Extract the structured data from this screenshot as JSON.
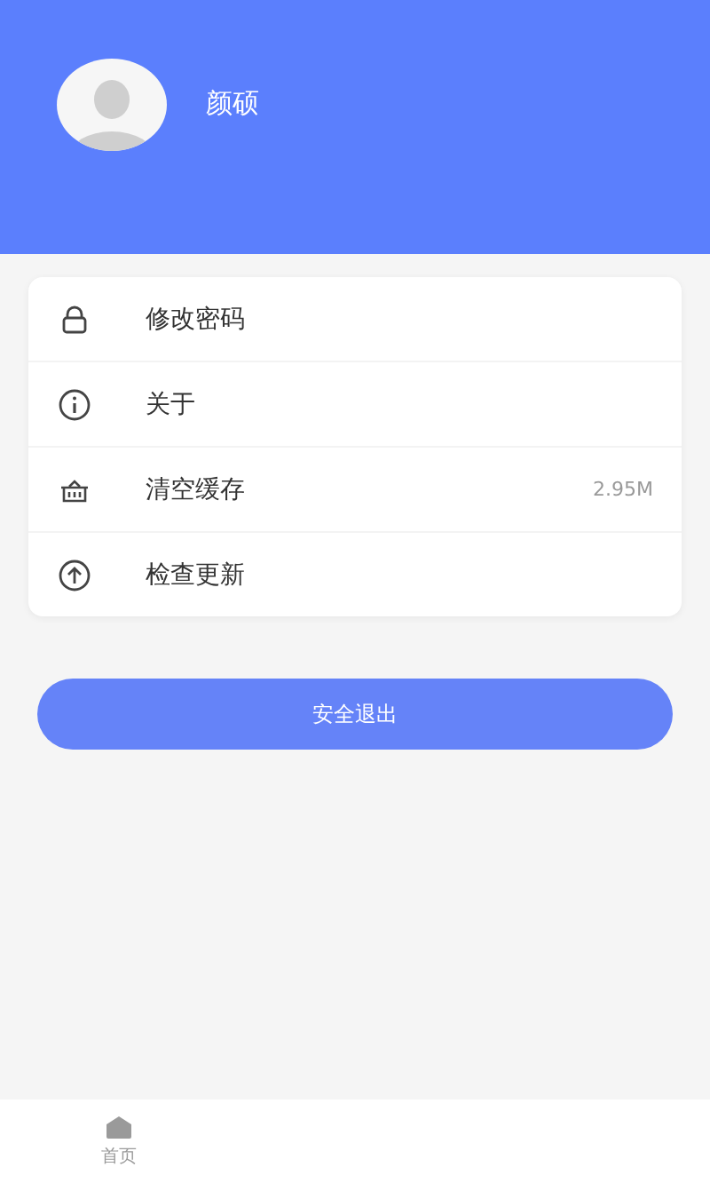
{
  "profile": {
    "name": "颜硕"
  },
  "menu": [
    {
      "kind": "lock",
      "label": "修改密码"
    },
    {
      "kind": "info",
      "label": "关于"
    },
    {
      "kind": "basket",
      "label": "清空缓存",
      "value": "2.95M"
    },
    {
      "kind": "upload",
      "label": "检查更新"
    }
  ],
  "logout_button": "安全退出",
  "tab_bar": [
    {
      "label": "首页",
      "selected": false
    }
  ]
}
